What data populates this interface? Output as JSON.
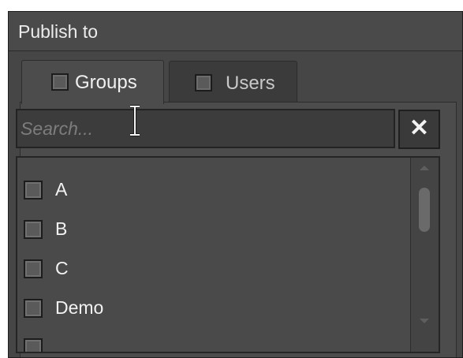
{
  "window": {
    "title": "Publish to"
  },
  "tabs": [
    {
      "label": "Groups",
      "active": true,
      "checked": false
    },
    {
      "label": "Users",
      "active": false,
      "checked": false
    }
  ],
  "search": {
    "value": "",
    "placeholder": "Search...",
    "clear_label": "✕",
    "clear_icon": "close-icon"
  },
  "list": {
    "items": [
      {
        "label": "A",
        "checked": false
      },
      {
        "label": "B",
        "checked": false
      },
      {
        "label": "C",
        "checked": false
      },
      {
        "label": "Demo",
        "checked": false
      }
    ]
  },
  "scrollbar": {
    "up_icon": "arrow-up-icon",
    "down_icon": "arrow-down-icon"
  },
  "colors": {
    "panel_bg": "#464646",
    "title_bg": "#4a4a4a",
    "text": "#f2f2f2",
    "input_bg": "#3c3c3c"
  }
}
